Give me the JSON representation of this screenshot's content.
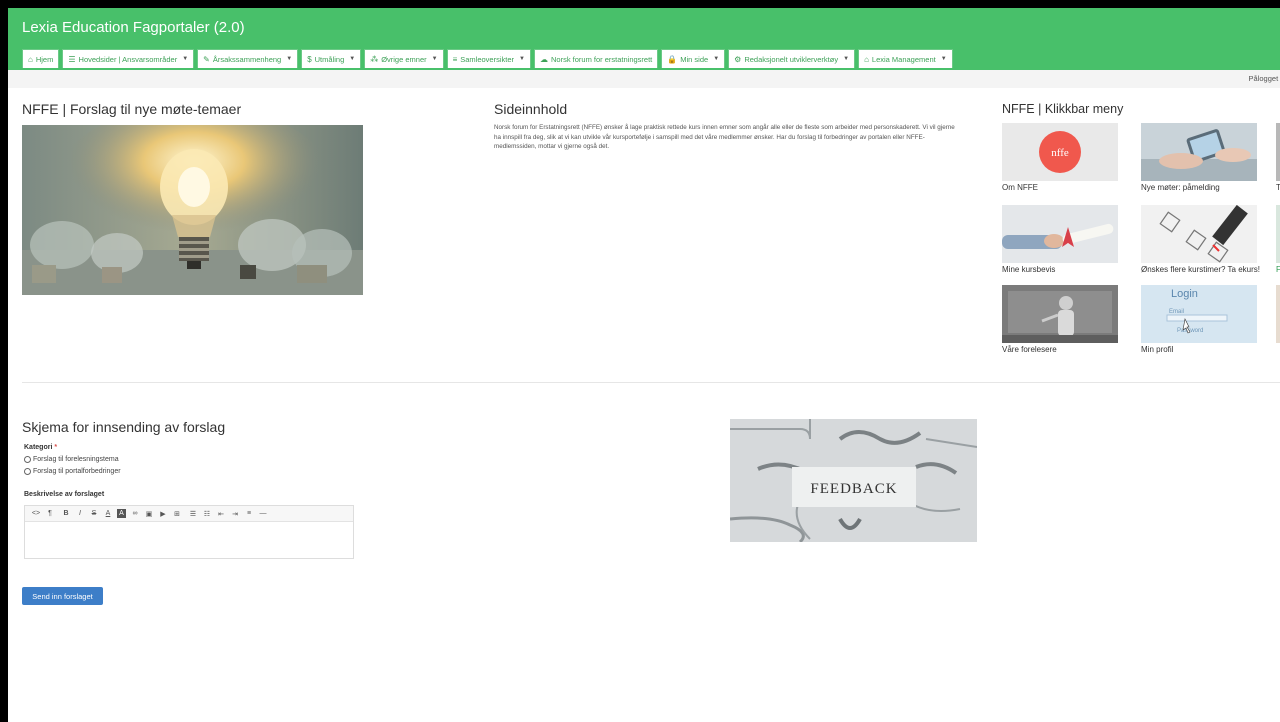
{
  "app": {
    "title": "Lexia Education Fagportaler (2.0)"
  },
  "nav": [
    {
      "icon": "home-icon",
      "glyph": "⌂",
      "label": "Hjem",
      "caret": false
    },
    {
      "icon": "book-stack-icon",
      "glyph": "☰",
      "label": "Hovedsider | Ansvarsområder",
      "caret": true
    },
    {
      "icon": "tag-icon",
      "glyph": "✎",
      "label": "Årsakssammenheng",
      "caret": true
    },
    {
      "icon": "dollar-icon",
      "glyph": "$",
      "label": "Utmåling",
      "caret": true
    },
    {
      "icon": "network-icon",
      "glyph": "⁂",
      "label": "Øvrige emner",
      "caret": true
    },
    {
      "icon": "list-icon",
      "glyph": "≡",
      "label": "Samleoversikter",
      "caret": true
    },
    {
      "icon": "comments-icon",
      "glyph": "☁",
      "label": "Norsk forum for erstatningsrett",
      "caret": false
    },
    {
      "icon": "lock-icon",
      "glyph": "🔒",
      "label": "Min side",
      "caret": true
    },
    {
      "icon": "cogs-icon",
      "glyph": "⚙",
      "label": "Redaksjonelt utviklerverktøy",
      "caret": true
    },
    {
      "icon": "bank-icon",
      "glyph": "⌂",
      "label": "Lexia Management",
      "caret": true
    }
  ],
  "status": {
    "logged_in": "Pålogget s"
  },
  "main": {
    "title": "NFFE | Forslag til nye møte-temaer",
    "sideinnhold_title": "Sideinnhold",
    "sideinnhold_text": "Norsk forum for Erstatningsrett (NFFE) ønsker å lage praktisk rettede kurs innen emner som angår alle eller de fleste som arbeider med personskaderett. Vi vil gjerne ha innspill fra deg, slik at vi kan utvikle vår kursportefølje i samspill med det våre medlemmer ønsker. Har du forslag til forbedringer av portalen eller NFFE-medlemssiden, mottar vi gjerne også det."
  },
  "menu": {
    "title": "NFFE | Klikkbar meny",
    "tiles": [
      {
        "label": "Om NFFE",
        "logo_text": "nffe"
      },
      {
        "label": "Nye møter: påmelding"
      },
      {
        "label": "T"
      },
      {
        "label": "Mine kursbevis"
      },
      {
        "label": "Ønskes flere kurstimer? Ta ekurs!"
      },
      {
        "label": "F"
      },
      {
        "label": "Våre forelesere"
      },
      {
        "label": "Min profil",
        "login_text": "Login",
        "email_text": "Email",
        "password_text": "Password"
      },
      {
        "label": ""
      }
    ]
  },
  "form": {
    "title": "Skjema for innsending av forslag",
    "kategori_label": "Kategori",
    "required_mark": "*",
    "options": [
      "Forslag til forelesningstema",
      "Forslag til portalforbedringer"
    ],
    "beskrivelse_label": "Beskrivelse av forslaget",
    "submit_label": "Send inn forslaget",
    "feedback_word": "FEEDBACK"
  },
  "toolbar": [
    {
      "name": "code-view-icon",
      "glyph": "<>"
    },
    {
      "name": "paragraph-icon",
      "glyph": "¶"
    },
    {
      "name": "bold-icon",
      "glyph": "B"
    },
    {
      "name": "italic-icon",
      "glyph": "I"
    },
    {
      "name": "strikethrough-icon",
      "glyph": "S"
    },
    {
      "name": "font-color-icon",
      "glyph": "A"
    },
    {
      "name": "background-color-icon",
      "glyph": "A"
    },
    {
      "name": "link-icon",
      "glyph": "∞"
    },
    {
      "name": "image-icon",
      "glyph": "▣"
    },
    {
      "name": "video-icon",
      "glyph": "▶"
    },
    {
      "name": "table-icon",
      "glyph": "⊞"
    },
    {
      "name": "unordered-list-icon",
      "glyph": "☰"
    },
    {
      "name": "ordered-list-icon",
      "glyph": "☷"
    },
    {
      "name": "outdent-icon",
      "glyph": "⇤"
    },
    {
      "name": "indent-icon",
      "glyph": "⇥"
    },
    {
      "name": "align-icon",
      "glyph": "≡"
    },
    {
      "name": "horizontal-rule-icon",
      "glyph": "—"
    }
  ]
}
